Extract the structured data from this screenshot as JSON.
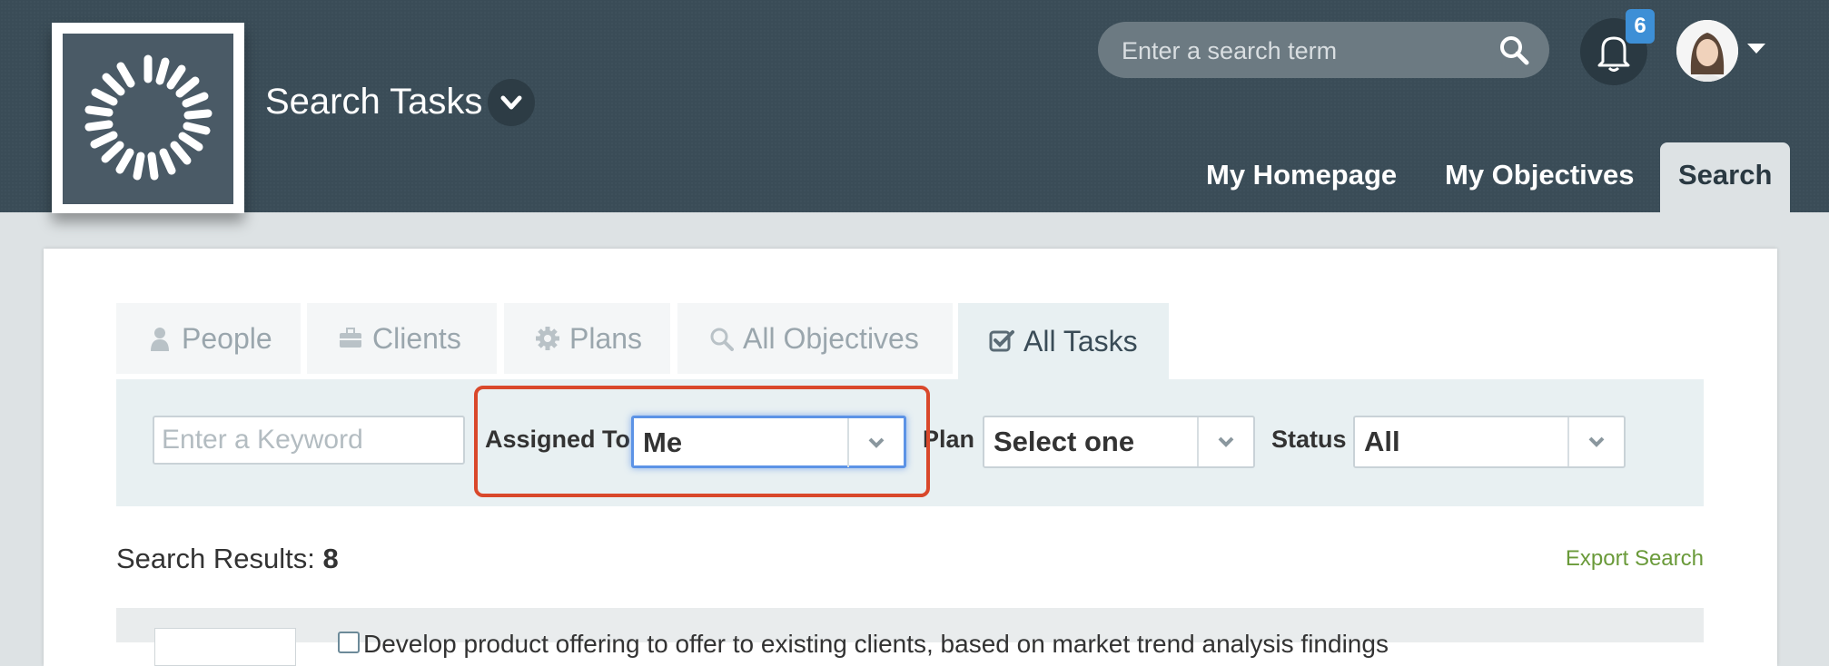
{
  "header": {
    "title": "Search Tasks",
    "search_placeholder": "Enter a search term",
    "notification_count": "6",
    "nav": [
      "My Homepage",
      "My Objectives",
      "Search"
    ]
  },
  "tabs": [
    {
      "label": "People",
      "icon": "person-icon"
    },
    {
      "label": "Clients",
      "icon": "briefcase-icon"
    },
    {
      "label": "Plans",
      "icon": "gear-icon"
    },
    {
      "label": "All Objectives",
      "icon": "search-icon"
    },
    {
      "label": "All Tasks",
      "icon": "checkbox-icon",
      "active": true
    }
  ],
  "filters": {
    "keyword_placeholder": "Enter a Keyword",
    "assigned_to_label": "Assigned To",
    "assigned_to_value": "Me",
    "plan_label": "Plan",
    "plan_value": "Select one",
    "status_label": "Status",
    "status_value": "All"
  },
  "results": {
    "label": "Search Results:",
    "count": "8",
    "export_label": "Export Search",
    "first_item": "Develop product offering to offer to existing clients, based on market trend analysis findings"
  },
  "colors": {
    "header_bg": "#3a4c57",
    "highlight": "#d9482b",
    "focus": "#5c93e6",
    "link_green": "#6a9a3a",
    "badge": "#3d8fd6"
  }
}
